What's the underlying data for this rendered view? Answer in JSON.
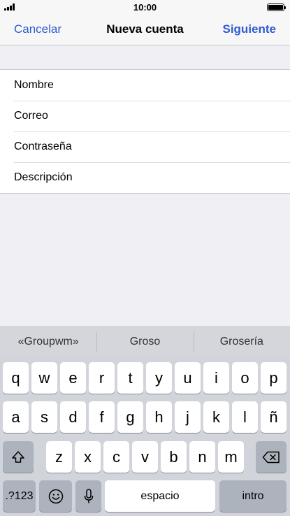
{
  "status_bar": {
    "time": "10:00",
    "signal_icon": "signal-bars-icon",
    "battery_icon": "battery-icon",
    "battery_level": 1.0
  },
  "nav": {
    "cancel_label": "Cancelar",
    "title": "Nueva cuenta",
    "next_label": "Siguiente"
  },
  "form": {
    "fields": [
      {
        "placeholder": "Nombre",
        "value": ""
      },
      {
        "placeholder": "Correo",
        "value": ""
      },
      {
        "placeholder": "Contraseña",
        "value": ""
      },
      {
        "placeholder": "Descripción",
        "value": ""
      }
    ]
  },
  "keyboard": {
    "suggestions": [
      "«Groupwm»",
      "Groso",
      "Grosería"
    ],
    "row1": [
      "q",
      "w",
      "e",
      "r",
      "t",
      "y",
      "u",
      "i",
      "o",
      "p"
    ],
    "row2": [
      "a",
      "s",
      "d",
      "f",
      "g",
      "h",
      "j",
      "k",
      "l",
      "ñ"
    ],
    "row3": [
      "z",
      "x",
      "c",
      "v",
      "b",
      "n",
      "m"
    ],
    "numbers_label": ".?123",
    "space_label": "espacio",
    "return_label": "intro",
    "shift_icon": "shift-icon",
    "delete_icon": "backspace-icon",
    "emoji_icon": "emoji-icon",
    "mic_icon": "microphone-icon"
  },
  "colors": {
    "accent": "#2e5cd0",
    "background": "#efeff4",
    "keyboard_bg": "#d1d4da"
  }
}
